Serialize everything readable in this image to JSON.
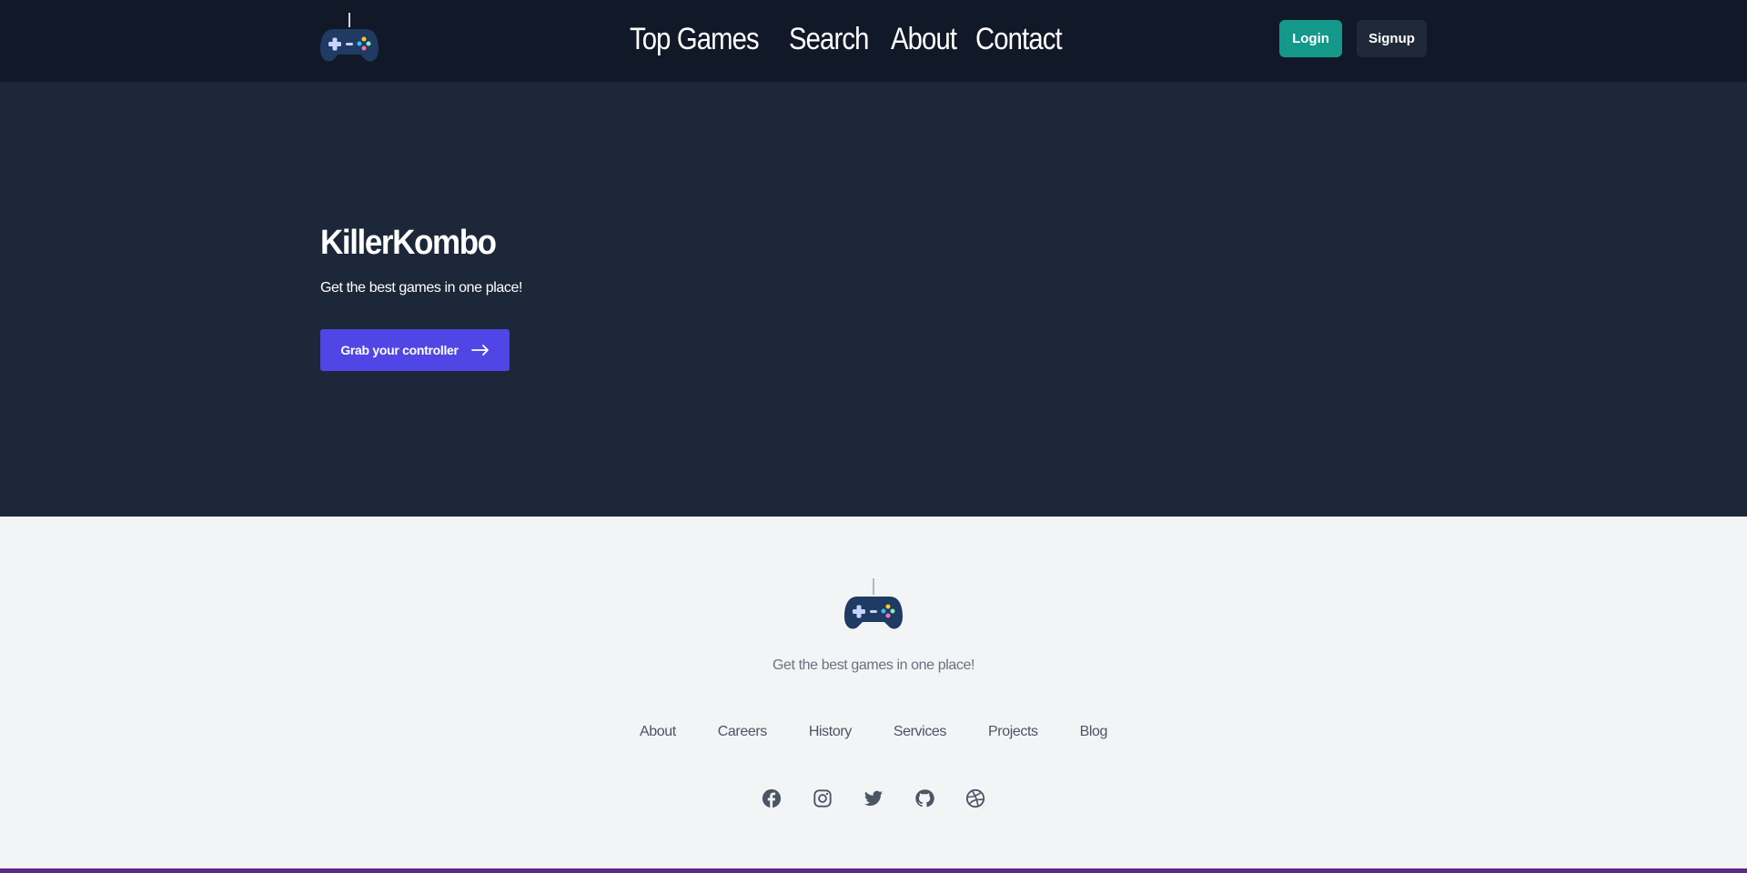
{
  "header": {
    "logo_icon": "gamepad-icon",
    "nav": [
      {
        "label": "Top Games"
      },
      {
        "label": "Search"
      },
      {
        "label": "About"
      },
      {
        "label": "Contact"
      }
    ],
    "login_label": "Login",
    "signup_label": "Signup"
  },
  "hero": {
    "title": "KillerKombo",
    "subtitle": "Get the best games in one place!",
    "cta_label": "Grab your controller",
    "cta_icon": "arrow-right-icon"
  },
  "footer": {
    "logo_icon": "gamepad-icon",
    "tagline": "Get the best games in one place!",
    "links": [
      {
        "label": "About"
      },
      {
        "label": "Careers"
      },
      {
        "label": "History"
      },
      {
        "label": "Services"
      },
      {
        "label": "Projects"
      },
      {
        "label": "Blog"
      }
    ],
    "social": [
      "facebook-icon",
      "instagram-icon",
      "twitter-icon",
      "github-icon",
      "dribbble-icon"
    ]
  },
  "colors": {
    "header_bg": "#111827",
    "hero_bg": "#1c2739",
    "footer_bg": "#f3f4f6",
    "login_button": "#14988a",
    "signup_button": "#1f2937",
    "cta_button": "#4f46e5",
    "bottom_strip": "#5b2a86"
  }
}
